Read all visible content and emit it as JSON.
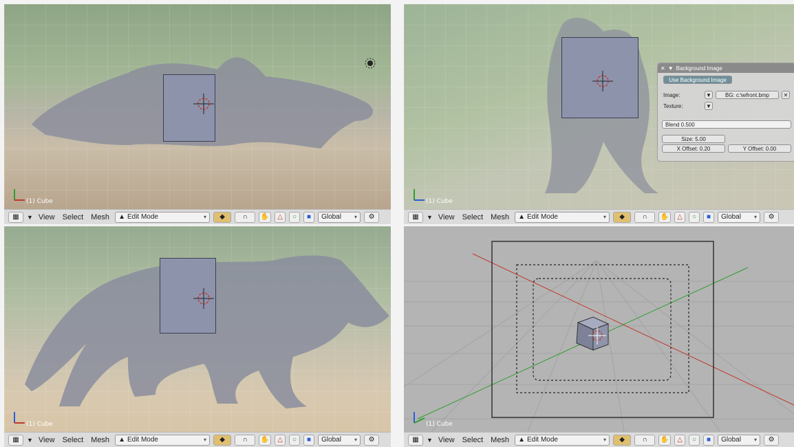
{
  "viewports": [
    {
      "object_label": "(1) Cube"
    },
    {
      "object_label": "(1) Cube"
    },
    {
      "object_label": "(1) Cube"
    },
    {
      "object_label": "(1) Cube"
    }
  ],
  "header": {
    "menu_view": "View",
    "menu_select": "Select",
    "menu_mesh": "Mesh",
    "mode": "Edit Mode",
    "orientation": "Global"
  },
  "bg_panel": {
    "title": "Background Image",
    "use_button": "Use Background Image",
    "image_label": "Image:",
    "image_value": "BG: c:\\wfront.bmp",
    "texture_label": "Texture:",
    "blend": "Blend 0.500",
    "size": "Size: 5.00",
    "x_offset": "X Offset: 0.20",
    "y_offset": "Y Offset: 0.00"
  },
  "colors": {
    "header_bg": "#dcdcdc",
    "cube_face": "#8e93ac",
    "grid_bg": "#b4b4b4",
    "axis_x": "#c0392b",
    "axis_y": "#2e9e2e"
  },
  "icons": [
    "grid-icon",
    "triangle-icon",
    "sphere-icon",
    "magnet-icon",
    "hand-icon",
    "sun-icon",
    "axis-gizmo-icon",
    "cursor-icon"
  ]
}
